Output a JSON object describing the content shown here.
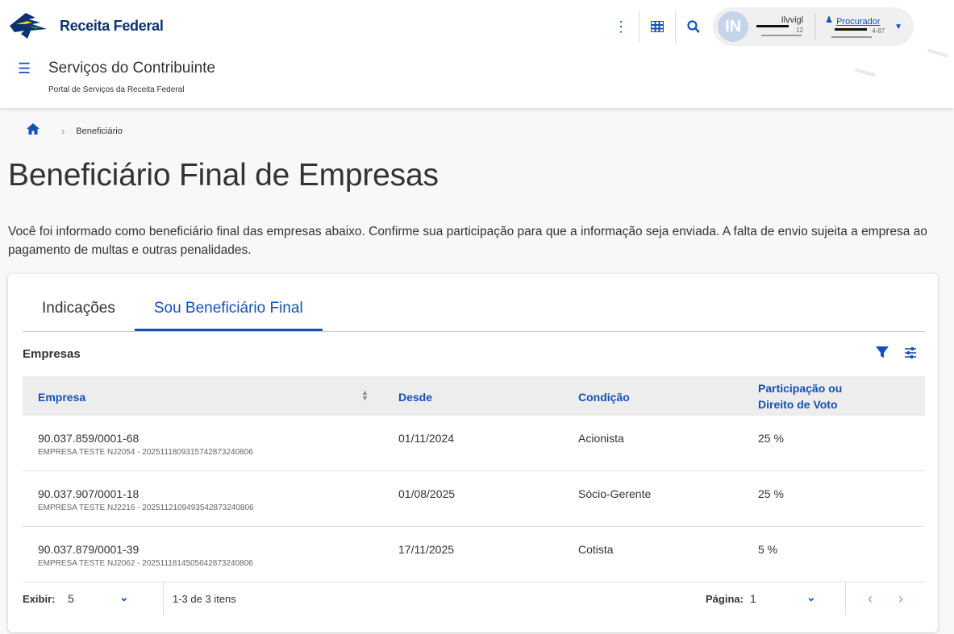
{
  "header": {
    "brand": "Receita Federal",
    "user": {
      "initials": "IN",
      "name": "Ilvvigl",
      "sub": "12"
    },
    "role": {
      "label": "Procurador",
      "sub": "4-87"
    },
    "service_title": "Serviços do Contribuinte",
    "service_subtitle": "Portal de Serviços da Receita Federal"
  },
  "breadcrumb": {
    "current": "Beneficiário"
  },
  "page": {
    "title": "Beneficiário Final de Empresas",
    "intro": "Você foi informado como beneficiário final das empresas abaixo. Confirme sua participação para que a informação seja enviada. A falta de envio sujeita a empresa ao pagamento de multas e outras penalidades."
  },
  "tabs": [
    {
      "label": "Indicações",
      "active": false
    },
    {
      "label": "Sou Beneficiário Final",
      "active": true
    }
  ],
  "table": {
    "title": "Empresas",
    "columns": {
      "empresa": "Empresa",
      "desde": "Desde",
      "condicao": "Condição",
      "participacao_l1": "Participação ou",
      "participacao_l2": "Direito de Voto"
    },
    "rows": [
      {
        "cnpj": "90.037.859/0001-68",
        "nome": "EMPRESA TESTE NJ2054 - 20251118093157428732408​06",
        "desde": "01/11/2024",
        "condicao": "Acionista",
        "participacao": "25 %"
      },
      {
        "cnpj": "90.037.907/0001-18",
        "nome": "EMPRESA TESTE NJ2216 - 2025112109493542873240806",
        "desde": "01/08/2025",
        "condicao": "Sócio-Gerente",
        "participacao": "25 %"
      },
      {
        "cnpj": "90.037.879/0001-39",
        "nome": "EMPRESA TESTE NJ2062 - 2025111814505642873240806",
        "desde": "17/11/2025",
        "condicao": "Cotista",
        "participacao": "5 %"
      }
    ]
  },
  "pagination": {
    "show_label": "Exibir:",
    "show_value": "5",
    "count": "1-3 de 3 itens",
    "page_label": "Página:",
    "page_value": "1"
  },
  "colors": {
    "primary": "#1351b4",
    "brand": "#0c326f"
  }
}
